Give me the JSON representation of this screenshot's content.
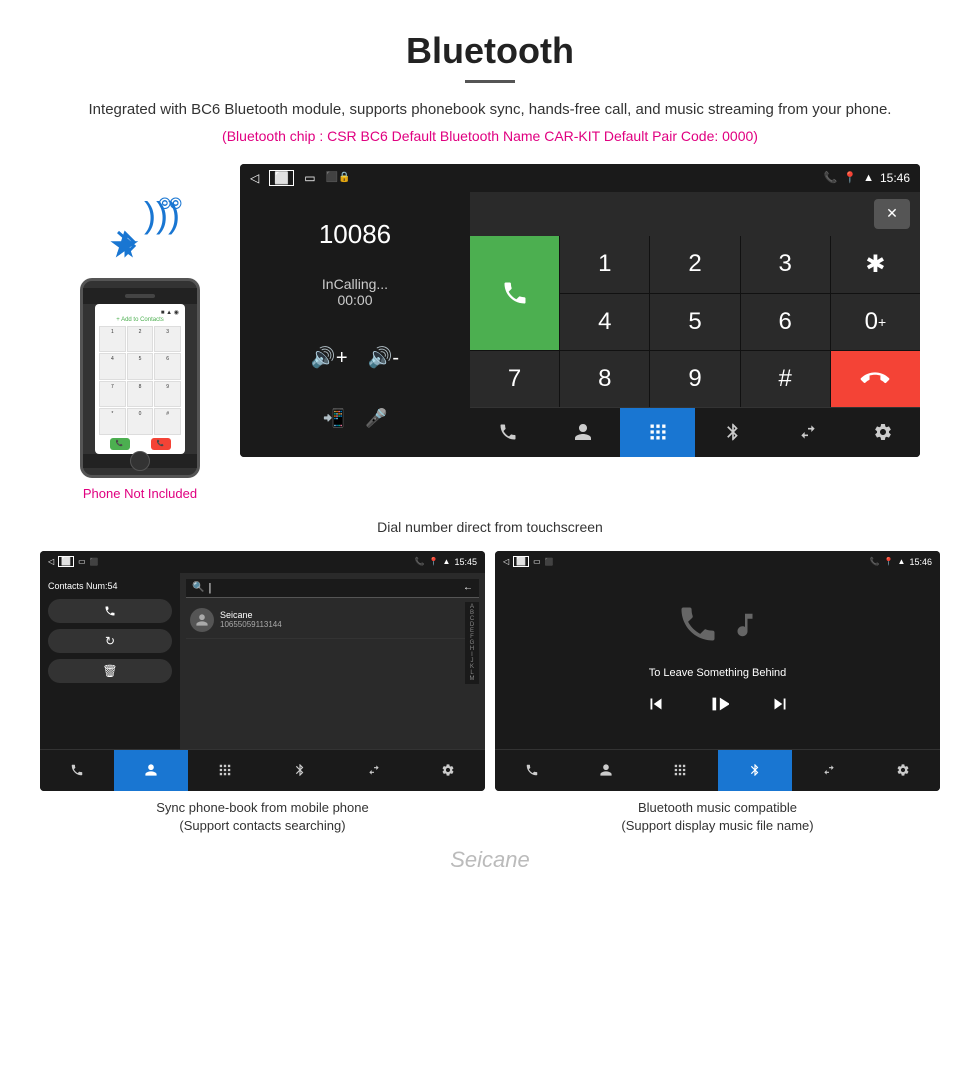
{
  "header": {
    "title": "Bluetooth",
    "subtitle": "Integrated with BC6 Bluetooth module, supports phonebook sync, hands-free call, and music streaming from your phone.",
    "specs": "(Bluetooth chip : CSR BC6    Default Bluetooth Name CAR-KIT    Default Pair Code: 0000)"
  },
  "phone_sidebar": {
    "not_included": "Phone Not Included"
  },
  "dial_screen": {
    "status_time": "15:46",
    "dialed_number": "10086",
    "call_status": "InCalling...",
    "call_timer": "00:00",
    "numpad_keys": [
      "1",
      "2",
      "3",
      "*",
      "",
      "4",
      "5",
      "6",
      "0+",
      "",
      "7",
      "8",
      "9",
      "#",
      ""
    ],
    "caption": "Dial number direct from touchscreen"
  },
  "contacts_screen": {
    "status_time": "15:45",
    "contacts_num": "Contacts Num:54",
    "contact_name": "Seicane",
    "contact_phone": "10655059113144",
    "alpha_list": [
      "A",
      "B",
      "C",
      "D",
      "E",
      "F",
      "G",
      "H",
      "I",
      "J",
      "K",
      "L",
      "M"
    ],
    "caption_line1": "Sync phone-book from mobile phone",
    "caption_line2": "(Support contacts searching)"
  },
  "music_screen": {
    "status_time": "15:46",
    "song_title": "To Leave Something Behind",
    "caption_line1": "Bluetooth music compatible",
    "caption_line2": "(Support display music file name)"
  },
  "nav_items": {
    "phone": "📞",
    "contacts": "👤",
    "keypad": "⌨",
    "bluetooth": "✱",
    "transfer": "⇄",
    "settings": "⚙"
  },
  "watermark": "Seicane"
}
